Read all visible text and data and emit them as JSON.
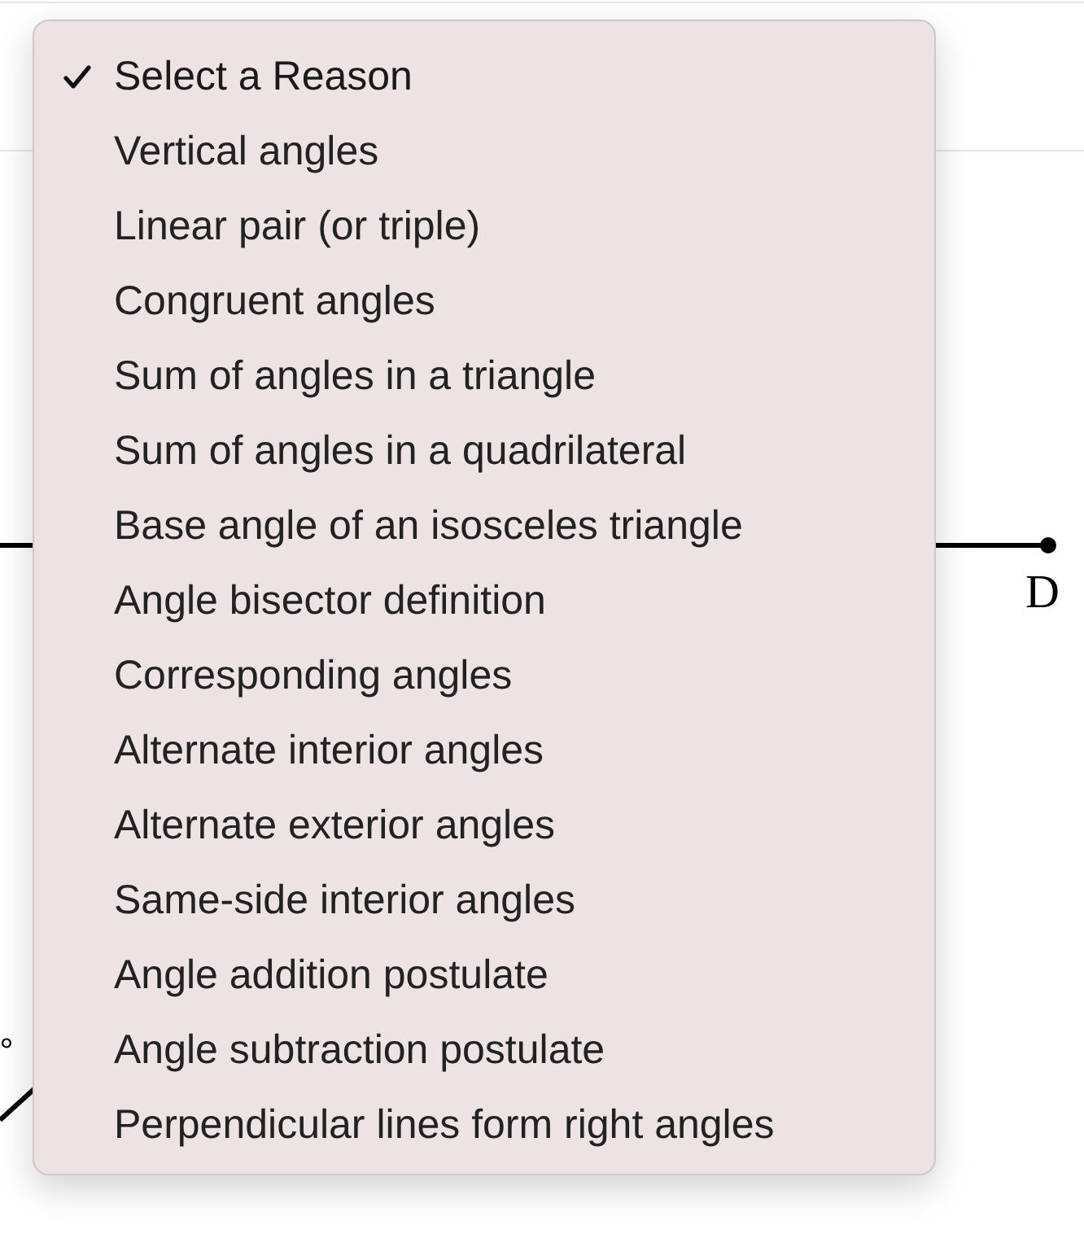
{
  "diagram": {
    "point_label": "D",
    "angle_mark": "°"
  },
  "menu": {
    "items": [
      {
        "label": "Select a Reason",
        "selected": true
      },
      {
        "label": "Vertical angles",
        "selected": false
      },
      {
        "label": "Linear pair (or triple)",
        "selected": false
      },
      {
        "label": "Congruent angles",
        "selected": false
      },
      {
        "label": "Sum of angles in a triangle",
        "selected": false
      },
      {
        "label": "Sum of angles in a quadrilateral",
        "selected": false
      },
      {
        "label": "Base angle of an isosceles triangle",
        "selected": false
      },
      {
        "label": "Angle bisector definition",
        "selected": false
      },
      {
        "label": "Corresponding angles",
        "selected": false
      },
      {
        "label": "Alternate interior angles",
        "selected": false
      },
      {
        "label": "Alternate exterior angles",
        "selected": false
      },
      {
        "label": "Same-side interior angles",
        "selected": false
      },
      {
        "label": "Angle addition postulate",
        "selected": false
      },
      {
        "label": "Angle subtraction postulate",
        "selected": false
      },
      {
        "label": "Perpendicular lines form right angles",
        "selected": false
      }
    ]
  }
}
